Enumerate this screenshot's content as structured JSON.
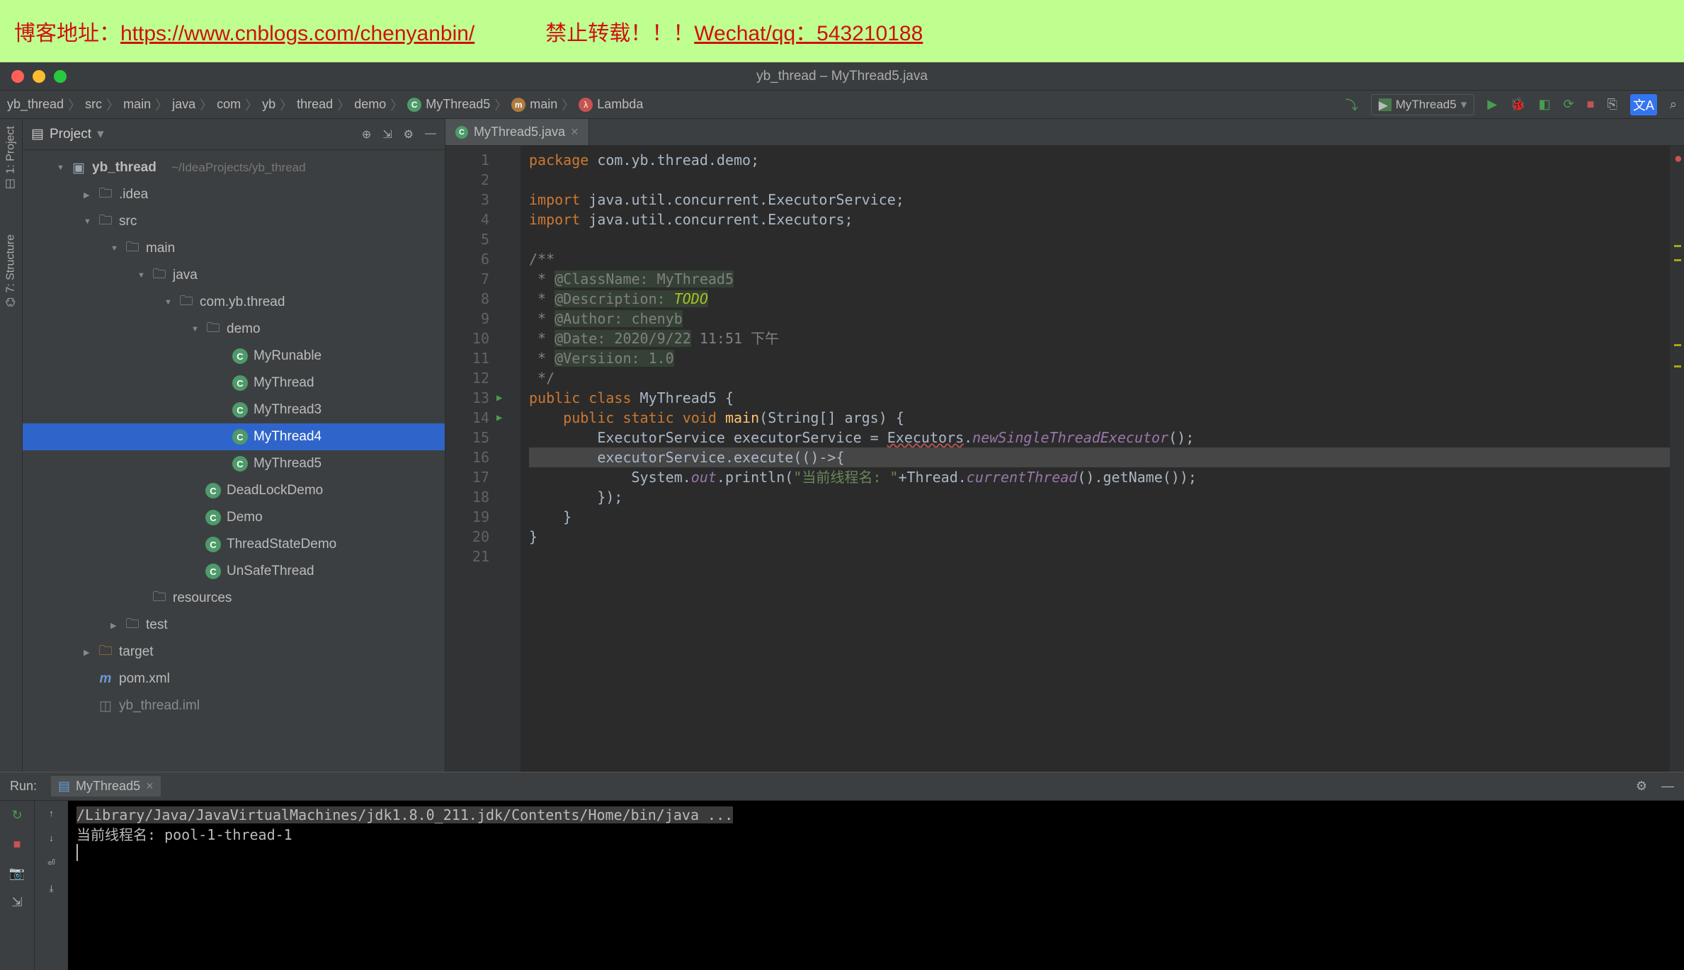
{
  "watermark": {
    "blog_label": "博客地址：",
    "blog_url": "https://www.cnblogs.com/chenyanbin/",
    "notice": "禁止转载！！！",
    "contact_label": "Wechat/qq：543210188"
  },
  "window": {
    "title": "yb_thread – MyThread5.java"
  },
  "breadcrumb": [
    "yb_thread",
    "src",
    "main",
    "java",
    "com",
    "yb",
    "thread",
    "demo",
    "MyThread5",
    "main",
    "Lambda"
  ],
  "run_config": {
    "selected": "MyThread5"
  },
  "sidebar": {
    "title": "Project",
    "root": {
      "name": "yb_thread",
      "path": "~/IdeaProjects/yb_thread"
    },
    "nodes": {
      "idea": ".idea",
      "src": "src",
      "main": "main",
      "java": "java",
      "pkg": "com.yb.thread",
      "demo": "demo",
      "resources": "resources",
      "test": "test",
      "target": "target",
      "pom": "pom.xml",
      "iml": "yb_thread.iml"
    },
    "classes": [
      "MyRunable",
      "MyThread",
      "MyThread3",
      "MyThread4",
      "MyThread5",
      "DeadLockDemo",
      "Demo",
      "ThreadStateDemo",
      "UnSafeThread"
    ]
  },
  "tabs": {
    "active": "MyThread5.java"
  },
  "code": {
    "lines_count": 21,
    "package": "com.yb.thread.demo",
    "import1": "java.util.concurrent.ExecutorService",
    "import2": "java.util.concurrent.Executors",
    "doc_class": "@ClassName: MyThread5",
    "doc_desc_label": "@Description: ",
    "doc_desc_val": "TODO",
    "doc_author": "@Author: chenyb",
    "doc_date_a": "@Date: 2020/9/22",
    "doc_date_b": " 11:51 下午",
    "doc_ver": "@Versiion: 1.0",
    "class_name": "MyThread5",
    "main_sig_args": "String[] args",
    "exec_type": "ExecutorService",
    "exec_var": "executorService",
    "exec_factory": "Executors",
    "exec_method": "newSingleThreadExecutor",
    "print_str": "\"当前线程名: \"",
    "thread_cls": "Thread",
    "current_thread": "currentThread",
    "get_name": "getName"
  },
  "run": {
    "label": "Run:",
    "tab": "MyThread5",
    "cmd": "/Library/Java/JavaVirtualMachines/jdk1.8.0_211.jdk/Contents/Home/bin/java ...",
    "out1": "当前线程名: pool-1-thread-1"
  },
  "left_tabs": {
    "project": "1: Project",
    "structure": "7: Structure"
  }
}
